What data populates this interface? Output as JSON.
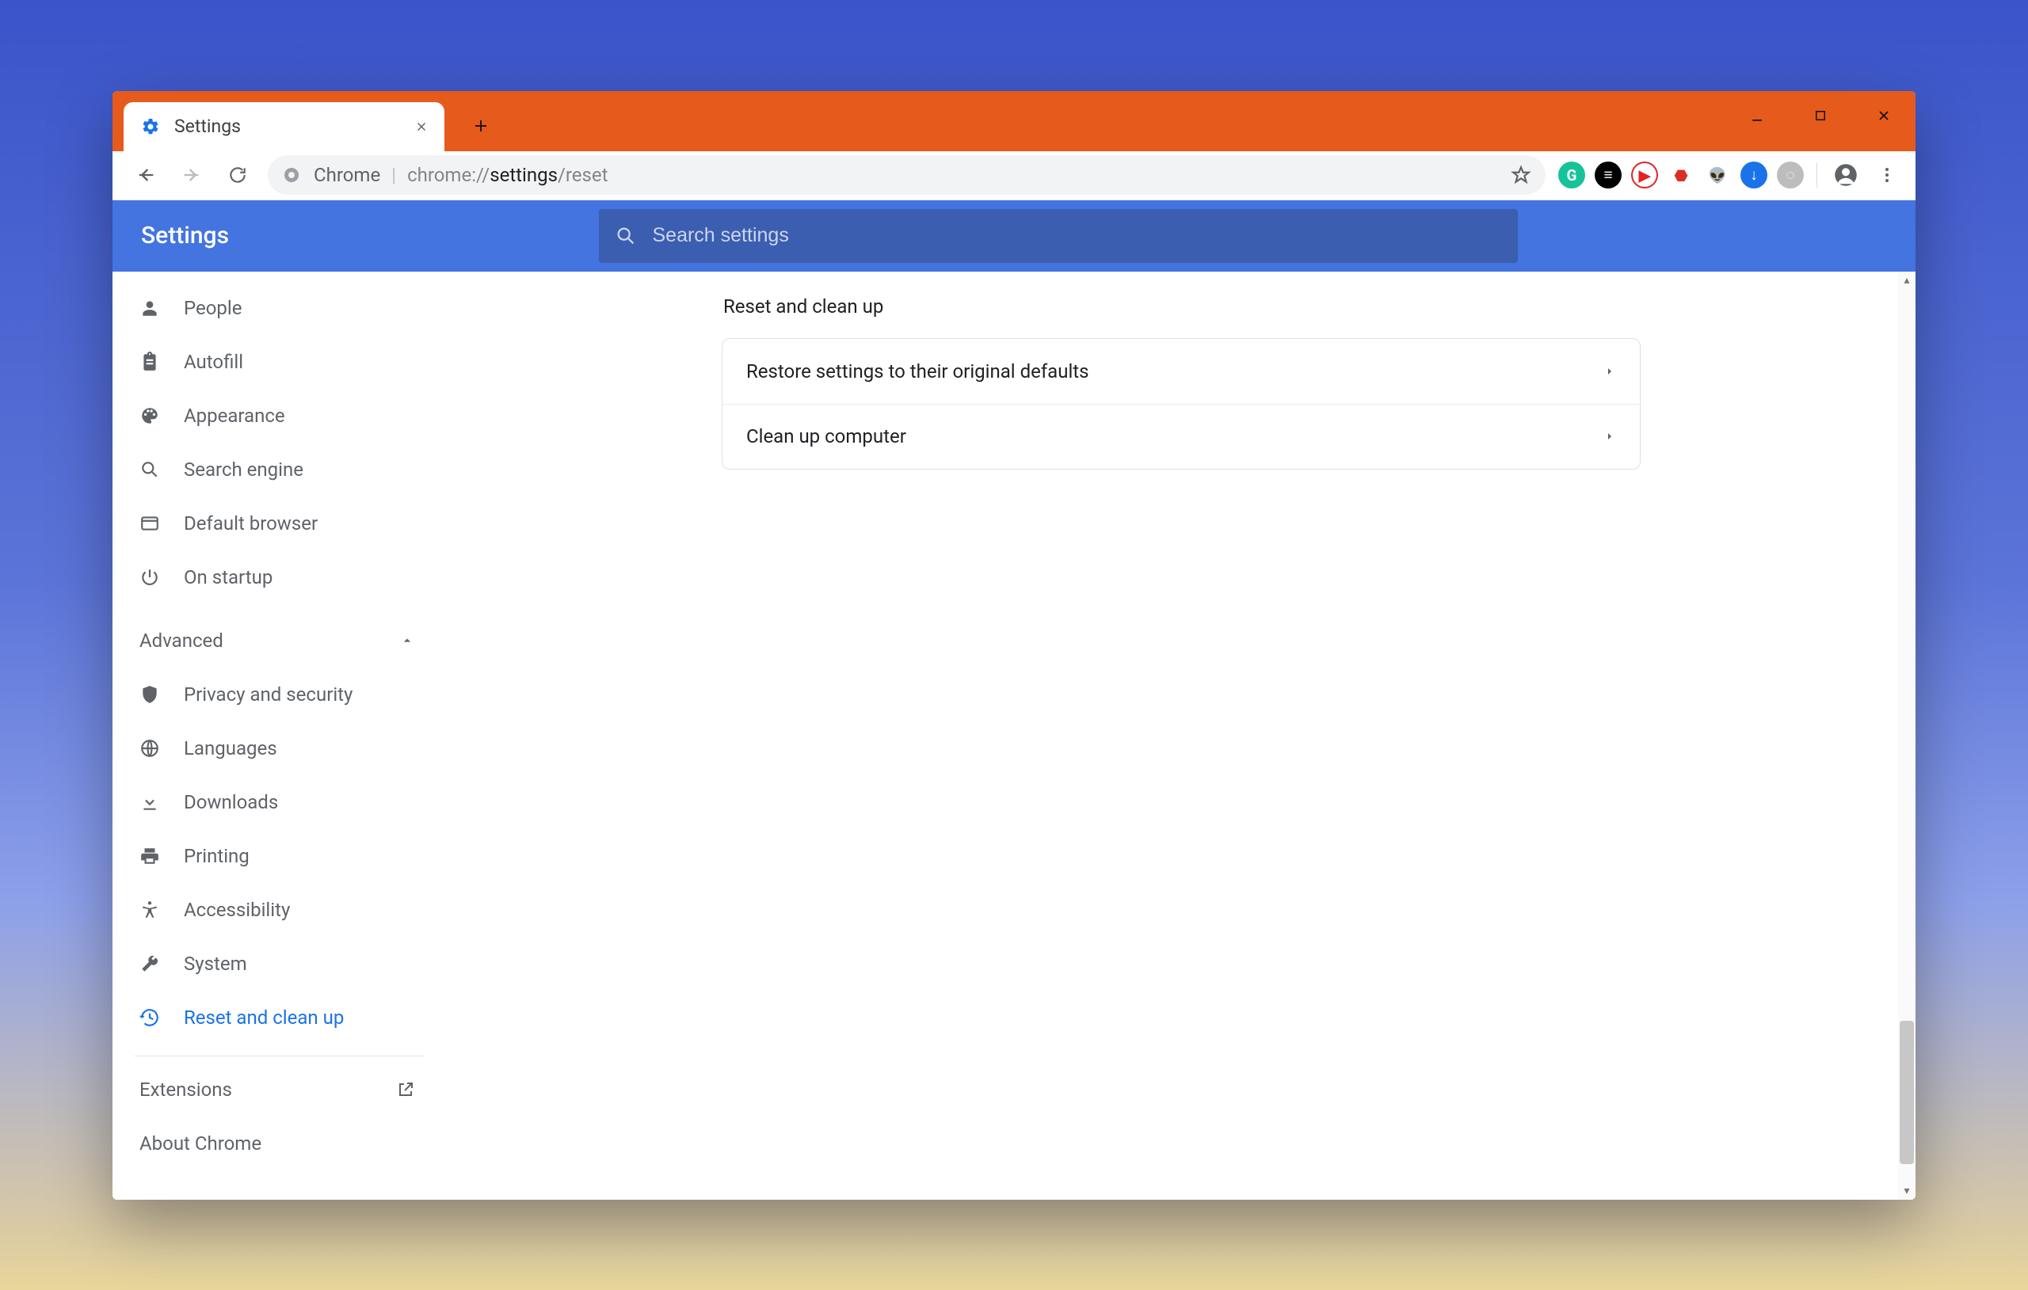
{
  "window": {
    "tab_title": "Settings",
    "omnibox": {
      "chip_label": "Chrome",
      "url_prefix": "chrome://",
      "url_strong": "settings",
      "url_suffix": "/reset"
    }
  },
  "extensions": [
    {
      "name": "grammarly-icon",
      "glyph": "G",
      "bg": "#15c39a"
    },
    {
      "name": "buffer-icon",
      "glyph": "≡",
      "bg": "#000000"
    },
    {
      "name": "youtube-icon",
      "glyph": "▶",
      "bg": "#ffffff",
      "fg": "#e02424",
      "border": "#e02424"
    },
    {
      "name": "ublock-icon",
      "glyph": "⬣",
      "bg": "#ffffff",
      "fg": "#d93025"
    },
    {
      "name": "reddit-icon",
      "glyph": "👽",
      "bg": "#ffffff",
      "fg": "#ff4500"
    },
    {
      "name": "download-icon",
      "glyph": "↓",
      "bg": "#1a73e8"
    },
    {
      "name": "disabled-ext-icon",
      "glyph": "◌",
      "bg": "#bdbdbd"
    }
  ],
  "header": {
    "title": "Settings"
  },
  "search": {
    "placeholder": "Search settings"
  },
  "sidebar": {
    "basic": [
      {
        "id": "people",
        "label": "People",
        "icon": "person"
      },
      {
        "id": "autofill",
        "label": "Autofill",
        "icon": "clipboard"
      },
      {
        "id": "appearance",
        "label": "Appearance",
        "icon": "palette"
      },
      {
        "id": "search",
        "label": "Search engine",
        "icon": "search"
      },
      {
        "id": "default",
        "label": "Default browser",
        "icon": "window"
      },
      {
        "id": "startup",
        "label": "On startup",
        "icon": "power"
      }
    ],
    "advanced_label": "Advanced",
    "advanced": [
      {
        "id": "privacy",
        "label": "Privacy and security",
        "icon": "shield"
      },
      {
        "id": "languages",
        "label": "Languages",
        "icon": "globe"
      },
      {
        "id": "downloads",
        "label": "Downloads",
        "icon": "download"
      },
      {
        "id": "printing",
        "label": "Printing",
        "icon": "print"
      },
      {
        "id": "accessibility",
        "label": "Accessibility",
        "icon": "accessibility"
      },
      {
        "id": "system",
        "label": "System",
        "icon": "wrench"
      },
      {
        "id": "reset",
        "label": "Reset and clean up",
        "icon": "history",
        "active": true
      }
    ],
    "extensions_label": "Extensions",
    "about_label": "About Chrome"
  },
  "page": {
    "section_title": "Reset and clean up",
    "rows": [
      {
        "label": "Restore settings to their original defaults"
      },
      {
        "label": "Clean up computer"
      }
    ]
  }
}
